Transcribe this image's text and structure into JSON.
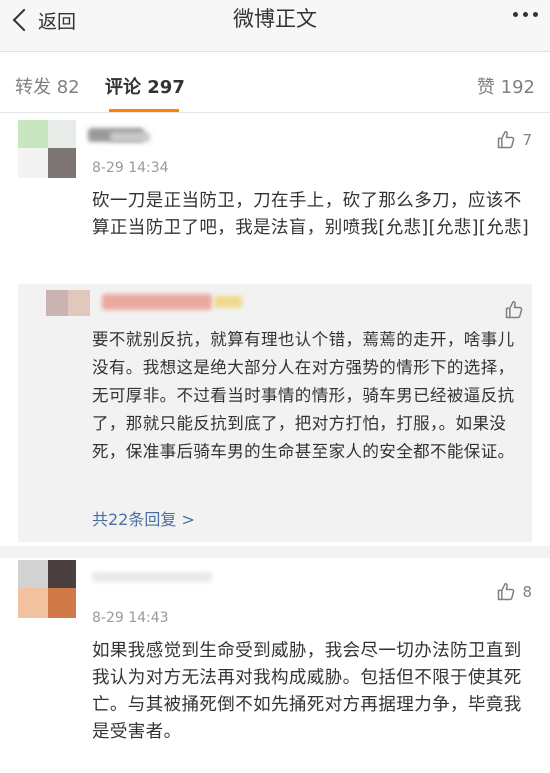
{
  "nav": {
    "back_label": "返回",
    "title": "微博正文"
  },
  "tabs": {
    "forward": "转发 82",
    "comments": "评论 297",
    "likes": "赞 192"
  },
  "comments": [
    {
      "time": "8-29 14:34",
      "likes": "7",
      "text": "砍一刀是正当防卫，刀在手上，砍了那么多刀，应该不算正当防卫了吧，我是法盲，别喷我[允悲][允悲][允悲]",
      "reply": {
        "text": "要不就别反抗，就算有理也认个错，蔫蔫的走开，啥事儿没有。我想这是绝大部分人在对方强势的情形下的选择，无可厚非。不过看当时事情的情形，骑车男已经被逼反抗了，那就只能反抗到底了，把对方打怕，打服，。如果没死，保准事后骑车男的生命甚至家人的安全都不能保证。",
        "more": "共22条回复 >"
      }
    },
    {
      "time": "8-29 14:43",
      "likes": "8",
      "text": "如果我感觉到生命受到威胁，我会尽一切办法防卫直到我认为对方无法再对我构成威胁。包括但不限于使其死亡。与其被捅死倒不如先捅死对方再据理力争，毕竟我是受害者。"
    }
  ],
  "colors": {
    "accent": "#ff8200",
    "link": "#4a6fa5",
    "meta": "#9a9a9a"
  },
  "icons": {
    "back": "chevron-left-icon",
    "more": "more-dots-icon",
    "like": "thumbs-up-icon"
  }
}
